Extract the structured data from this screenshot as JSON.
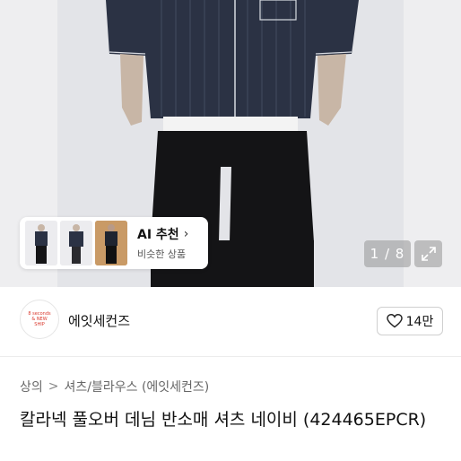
{
  "gallery": {
    "ai_card": {
      "title": "AI 추천",
      "subtitle": "비슷한 상품",
      "chevron": "›"
    },
    "pager_text": "1 / 8",
    "expand_icon": "expand-icon"
  },
  "brand": {
    "logo_lines": [
      "8 seconds",
      "& NEW",
      "SHIP"
    ],
    "name": "에잇세컨즈",
    "like_count": "14만",
    "like_icon": "heart-outline-icon"
  },
  "breadcrumb": {
    "level1": "상의",
    "separator": ">",
    "level2": "셔츠/블라우스 (에잇세컨즈)"
  },
  "product": {
    "title": "칼라넥 풀오버 데님 반소매 셔츠 네이비 (424465EPCR)"
  },
  "colors": {
    "accent": "#d9372b",
    "background": "#ffffff",
    "text": "#111111",
    "muted": "#666666"
  }
}
